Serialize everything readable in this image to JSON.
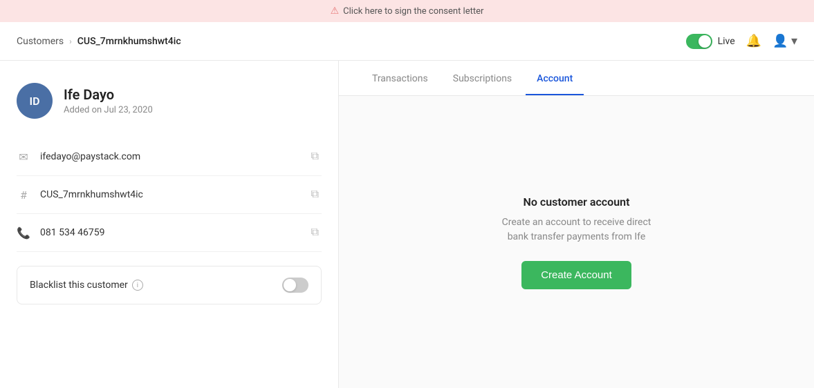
{
  "banner": {
    "icon": "⚠",
    "text": "Click here to sign the consent letter"
  },
  "navbar": {
    "breadcrumb_link": "Customers",
    "breadcrumb_separator": "›",
    "breadcrumb_current": "CUS_7mrnkhumshwt4ic",
    "live_label": "Live",
    "bell_icon": "🔔",
    "user_icon": "👤",
    "chevron_icon": "▾"
  },
  "left_panel": {
    "avatar_initials": "ID",
    "customer_name": "Ife Dayo",
    "customer_added": "Added on Jul 23, 2020",
    "email": "ifedayo@paystack.com",
    "customer_id": "CUS_7mrnkhumshwt4ic",
    "phone": "081 534 46759",
    "blacklist_label": "Blacklist this customer",
    "info_icon": "i"
  },
  "tabs": [
    {
      "label": "Transactions",
      "active": false
    },
    {
      "label": "Subscriptions",
      "active": false
    },
    {
      "label": "Account",
      "active": true
    }
  ],
  "account_panel": {
    "no_account_title": "No customer account",
    "no_account_desc": "Create an account to receive direct bank transfer payments from Ife",
    "create_account_btn": "Create Account"
  },
  "colors": {
    "accent_blue": "#1a56db",
    "accent_green": "#3bb75e",
    "avatar_blue": "#4a6fa5"
  }
}
